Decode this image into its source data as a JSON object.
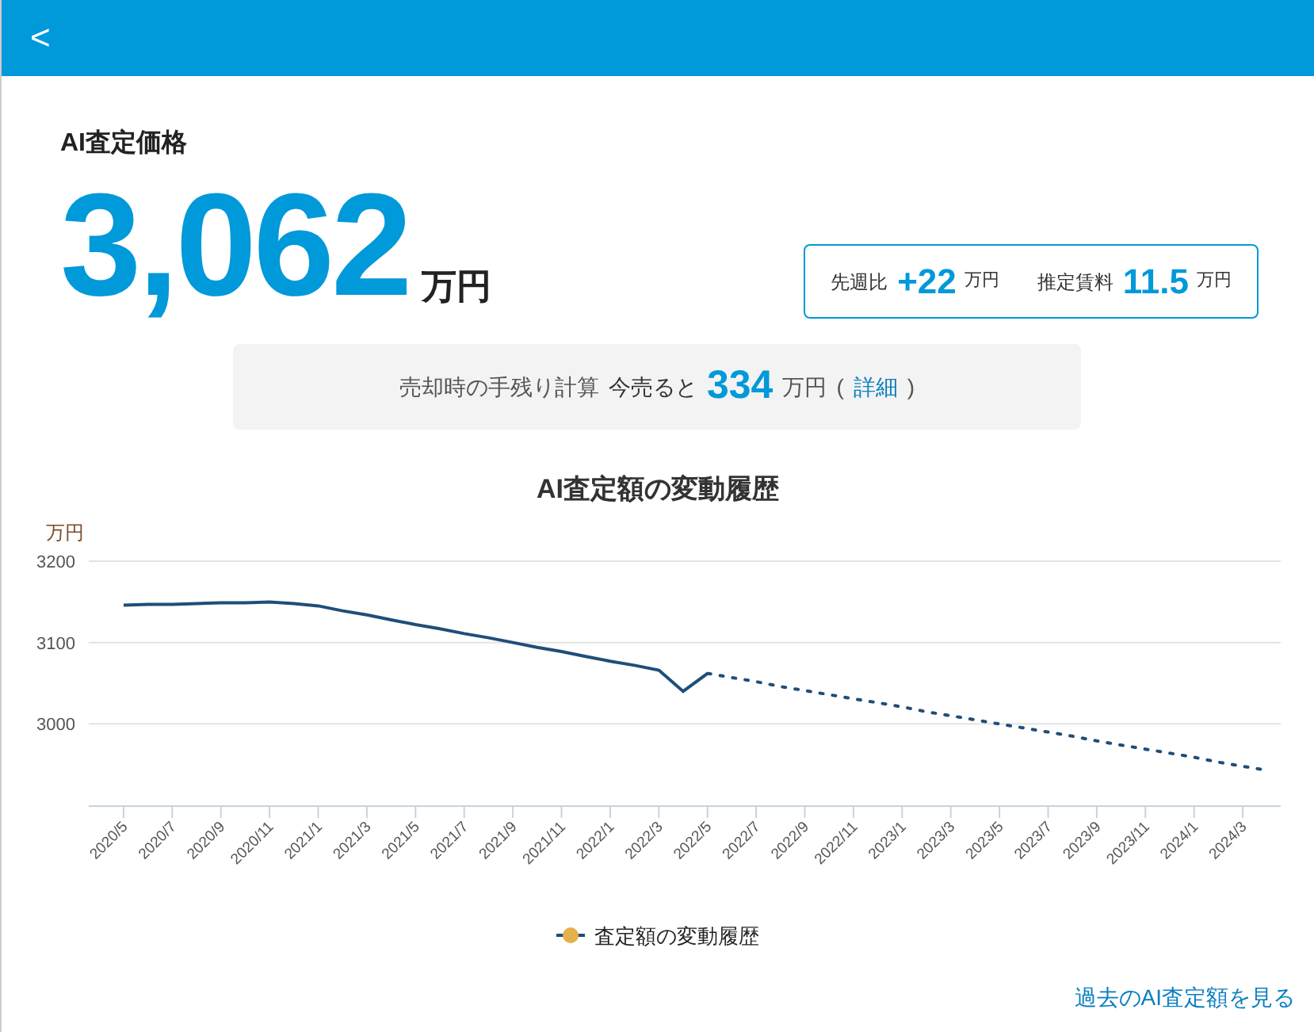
{
  "header": {
    "back": "<"
  },
  "appraisal": {
    "label": "AI査定価格",
    "value": "3,062",
    "unit": "万円"
  },
  "stats": [
    {
      "label": "先週比",
      "value": "+22",
      "unit": "万円"
    },
    {
      "label": "推定賃料",
      "value": "11.5",
      "unit": "万円"
    }
  ],
  "net_proceeds": {
    "label": "売却時の手残り計算",
    "prefix": "今売ると",
    "value": "334",
    "unit": "万円",
    "open": "(",
    "link": "詳細",
    "close": ")"
  },
  "chart": {
    "legend": [
      {
        "color": "#e6b04a"
      }
    ],
    "chart_data": {
      "type": "line",
      "title": "AI査定額の変動履歴",
      "ylabel": "万円",
      "categories": [
        "2020/5",
        null,
        "2020/7",
        null,
        "2020/9",
        null,
        "2020/11",
        null,
        "2021/1",
        null,
        "2021/3",
        null,
        "2021/5",
        null,
        "2021/7",
        null,
        "2021/9",
        null,
        "2021/11",
        null,
        "2022/1",
        null,
        "2022/3",
        null,
        "2022/5",
        null,
        "2022/7",
        null,
        "2022/9",
        null,
        "2022/11",
        null,
        "2023/1",
        null,
        "2023/3",
        null,
        "2023/5",
        null,
        "2023/7",
        null,
        "2023/9",
        null,
        "2023/11",
        null,
        "2024/1",
        null,
        "2024/3",
        null
      ],
      "series": [
        {
          "name": "査定額の変動履歴",
          "color": "#1f4e79",
          "line_style": "solid",
          "values": [
            3146,
            3147,
            3147,
            3148,
            3149,
            3149,
            3150,
            3148,
            3145,
            3139,
            3134,
            3128,
            3122,
            3117,
            3111,
            3106,
            3100,
            3094,
            3089,
            3083,
            3077,
            3072,
            3066,
            3040,
            3062,
            null,
            null,
            null,
            null,
            null,
            null,
            null,
            null,
            null,
            null,
            null,
            null,
            null,
            null,
            null,
            null,
            null,
            null,
            null,
            null,
            null,
            null,
            null
          ]
        },
        {
          "color": "#1f4e79",
          "line_style": "dotted",
          "values": [
            null,
            null,
            null,
            null,
            null,
            null,
            null,
            null,
            null,
            null,
            null,
            null,
            null,
            null,
            null,
            null,
            null,
            null,
            null,
            null,
            null,
            null,
            null,
            null,
            3062,
            3057,
            3052,
            3046,
            3041,
            3036,
            3031,
            3026,
            3021,
            3015,
            3010,
            3005,
            3000,
            2995,
            2990,
            2985,
            2979,
            2974,
            2969,
            2964,
            2959,
            2953,
            2948,
            2943
          ]
        }
      ],
      "ylim": [
        2900,
        3200
      ],
      "yticks": [
        3000,
        3100,
        3200
      ]
    }
  },
  "history_link": "過去のAI査定額を見る"
}
